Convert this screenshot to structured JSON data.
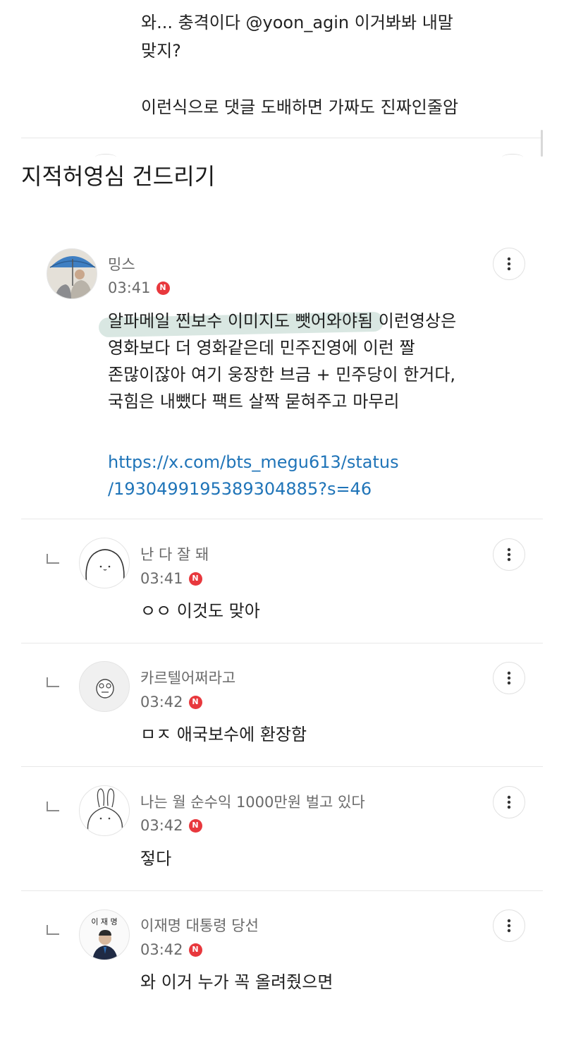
{
  "top_reply": {
    "line1": "와... 충격이다 @yoon_agin 이거봐봐 내말\n맞지?",
    "line2": "이런식으로 댓글 도배하면 가짜도 진짜인줄암"
  },
  "overlay_title": "지적허영심 건드리기",
  "main_comment": {
    "author": "밍스",
    "time": "03:41",
    "badge": "N",
    "text": "알파메일 찐보수 이미지도 뺏어와야됨 이런영상은\n영화보다 더 영화같은데 민주진영에 이런 짤\n존많이잖아 여기 웅장한 브금 + 민주당이 한거다,\n국힘은 내뺐다 팩트 살짝 묻혀주고 마무리",
    "link": "https://x.com/bts_megu613/status\n/1930499195389304885?s=46"
  },
  "replies": [
    {
      "author": "난 다 잘 돼",
      "time": "03:41",
      "badge": "N",
      "text": "ㅇㅇ 이것도 맞아"
    },
    {
      "author": "카르텔어쩌라고",
      "time": "03:42",
      "badge": "N",
      "text": "ㅁㅈ 애국보수에 환장함"
    },
    {
      "author": "나는 월 순수익 1000만원 벌고 있다",
      "time": "03:42",
      "badge": "N",
      "text": "젛다"
    },
    {
      "author": "이재명 대통령 당선",
      "time": "03:42",
      "badge": "N",
      "text": "와 이거 누가 꼭 올려줬으면",
      "avatar_text": "이 재 명"
    }
  ],
  "colors": {
    "badge": "#e8383d",
    "link": "#1f74b8",
    "meta": "#6a6a6a"
  }
}
